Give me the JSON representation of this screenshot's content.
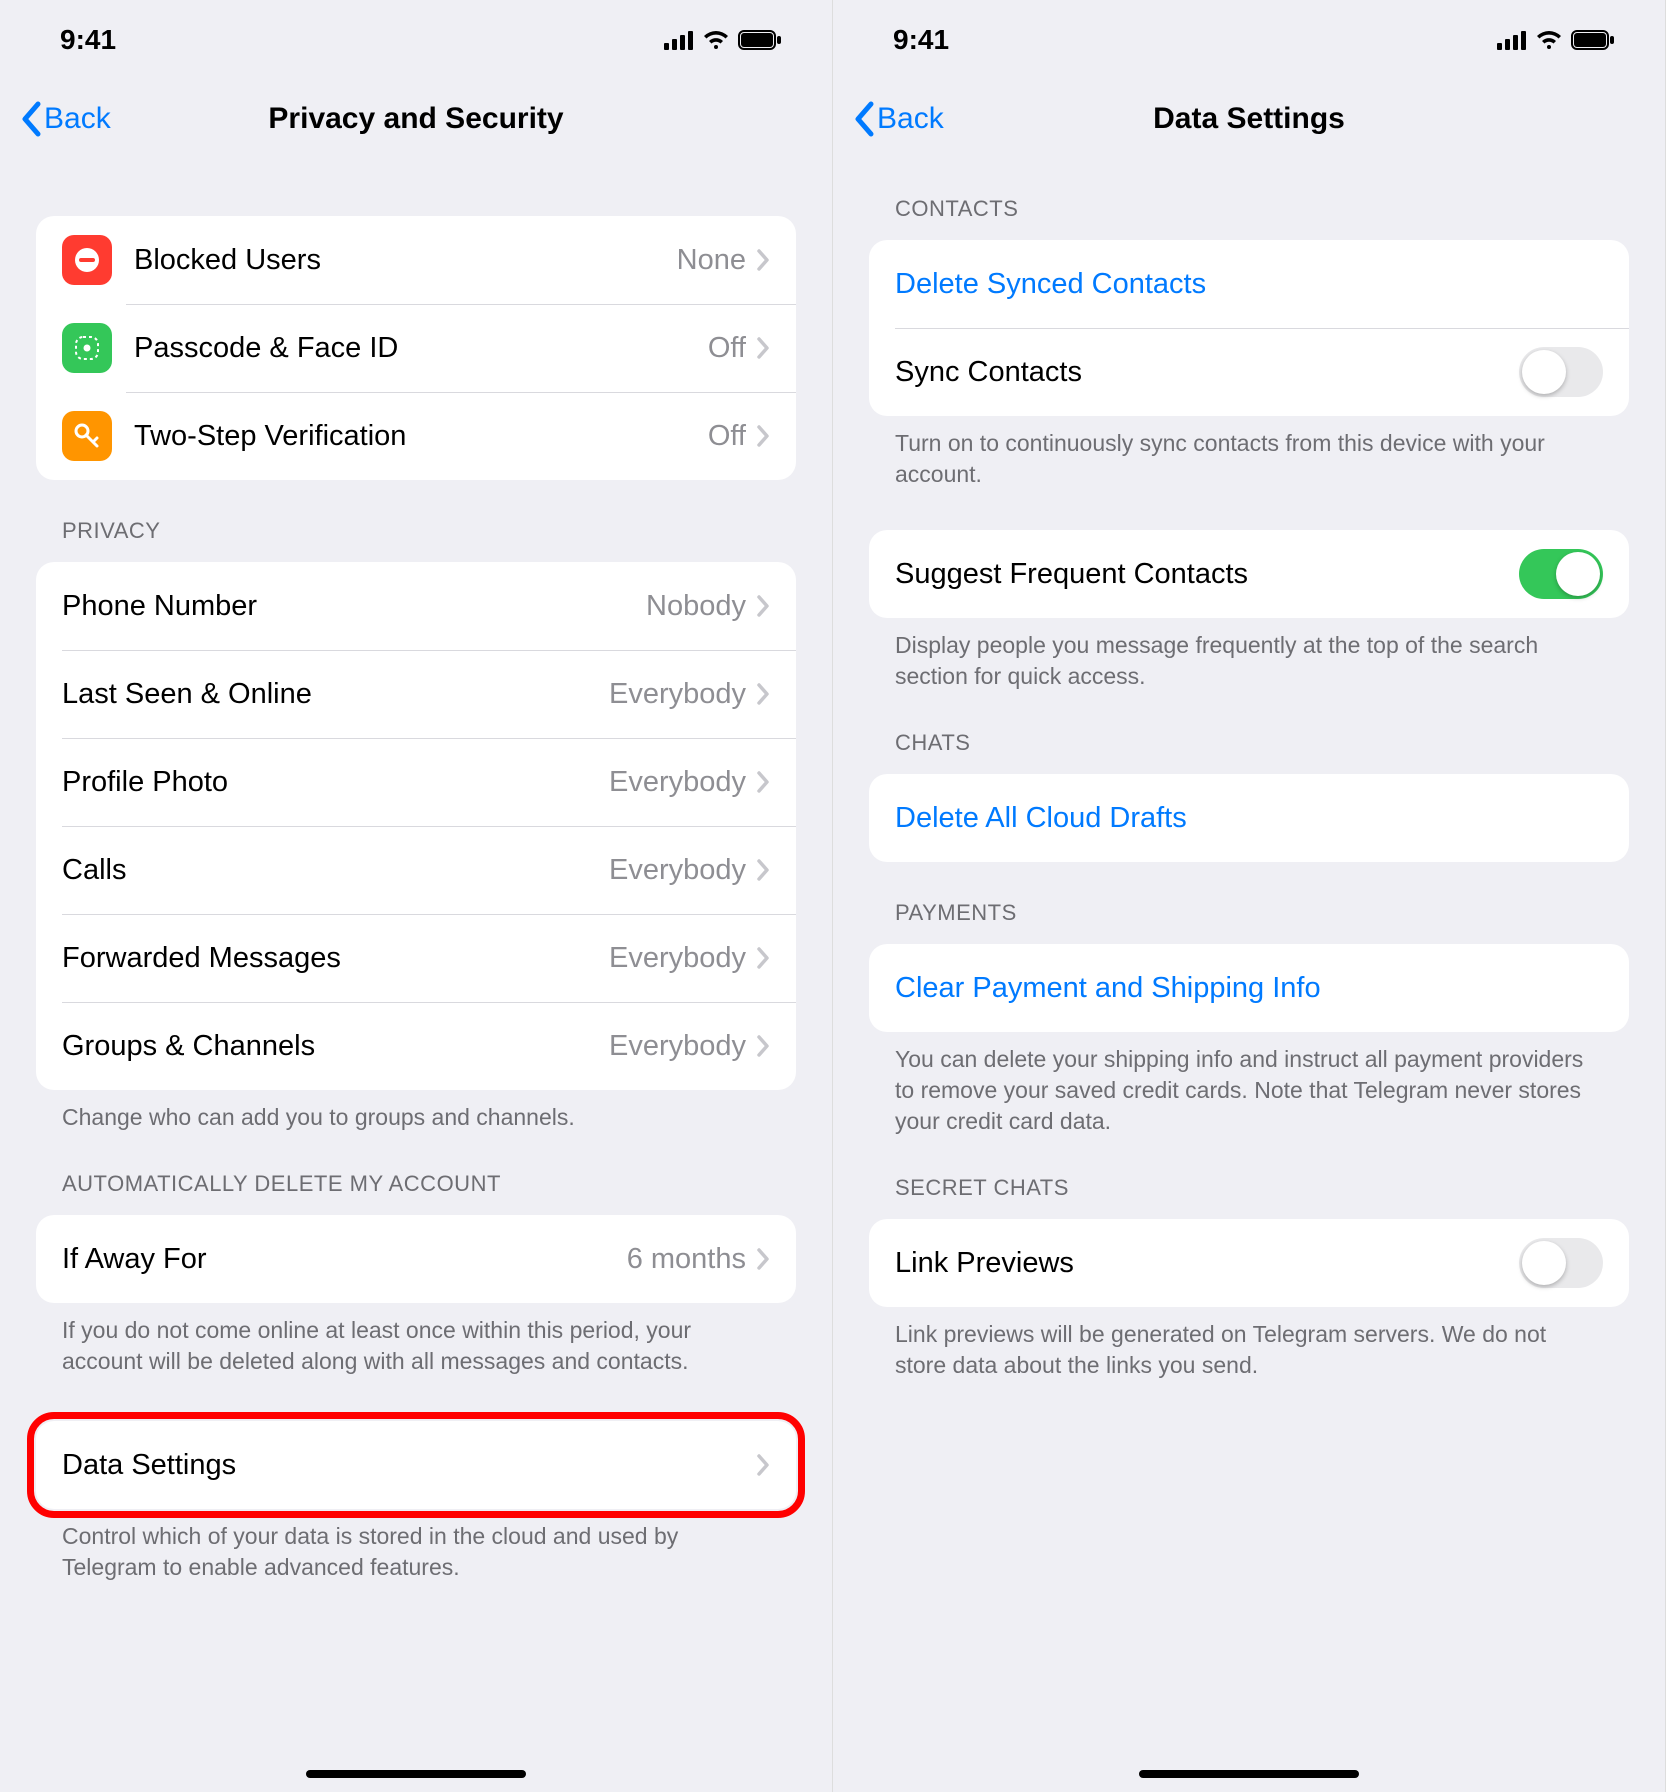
{
  "status": {
    "time": "9:41"
  },
  "left": {
    "back": "Back",
    "title": "Privacy and Security",
    "security_group": [
      {
        "icon": "blocked-icon",
        "icon_bg": "red",
        "label": "Blocked Users",
        "value": "None"
      },
      {
        "icon": "passcode-icon",
        "icon_bg": "green",
        "label": "Passcode & Face ID",
        "value": "Off"
      },
      {
        "icon": "key-icon",
        "icon_bg": "orange",
        "label": "Two-Step Verification",
        "value": "Off"
      }
    ],
    "privacy_header": "PRIVACY",
    "privacy_group": [
      {
        "label": "Phone Number",
        "value": "Nobody"
      },
      {
        "label": "Last Seen & Online",
        "value": "Everybody"
      },
      {
        "label": "Profile Photo",
        "value": "Everybody"
      },
      {
        "label": "Calls",
        "value": "Everybody"
      },
      {
        "label": "Forwarded Messages",
        "value": "Everybody"
      },
      {
        "label": "Groups & Channels",
        "value": "Everybody"
      }
    ],
    "privacy_footer": "Change who can add you to groups and channels.",
    "autodelete_header": "AUTOMATICALLY DELETE MY ACCOUNT",
    "autodelete_row": {
      "label": "If Away For",
      "value": "6 months"
    },
    "autodelete_footer": "If you do not come online at least once within this period, your account will be deleted along with all messages and contacts.",
    "data_settings_row": {
      "label": "Data Settings"
    },
    "data_settings_footer": "Control which of your data is stored in the cloud and used by Telegram to enable advanced features."
  },
  "right": {
    "back": "Back",
    "title": "Data Settings",
    "contacts_header": "CONTACTS",
    "delete_synced": "Delete Synced Contacts",
    "sync_contacts": {
      "label": "Sync Contacts",
      "on": false
    },
    "sync_footer": "Turn on to continuously sync contacts from this device with your account.",
    "suggest_frequent": {
      "label": "Suggest Frequent Contacts",
      "on": true
    },
    "suggest_footer": "Display people you message frequently at the top of the search section for quick access.",
    "chats_header": "CHATS",
    "delete_drafts": "Delete All Cloud Drafts",
    "payments_header": "PAYMENTS",
    "clear_payment": "Clear Payment and Shipping Info",
    "payments_footer": "You can delete your shipping info and instruct all payment providers to remove your saved credit cards. Note that Telegram never stores your credit card data.",
    "secret_header": "SECRET CHATS",
    "link_previews": {
      "label": "Link Previews",
      "on": false
    },
    "secret_footer": "Link previews will be generated on Telegram servers. We do not store data about the links you send."
  }
}
